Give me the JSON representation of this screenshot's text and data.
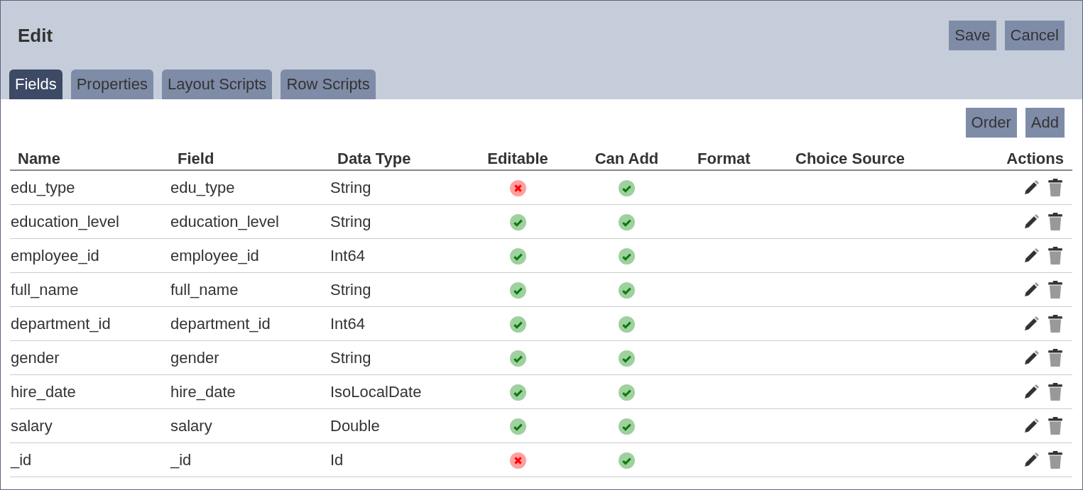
{
  "window": {
    "title": "Edit"
  },
  "header_buttons": [
    "Save",
    "Cancel"
  ],
  "tabs": [
    {
      "label": "Fields",
      "selected": true
    },
    {
      "label": "Properties",
      "selected": false
    },
    {
      "label": "Layout Scripts",
      "selected": false
    },
    {
      "label": "Row Scripts",
      "selected": false
    }
  ],
  "toolbar_buttons": [
    "Order",
    "Add"
  ],
  "table": {
    "columns": [
      "Name",
      "Field",
      "Data Type",
      "Editable",
      "Can Add",
      "Format",
      "Choice Source",
      "Actions"
    ],
    "rows": [
      {
        "name": "edu_type",
        "field": "edu_type",
        "data_type": "String",
        "editable": false,
        "can_add": true
      },
      {
        "name": "education_level",
        "field": "education_level",
        "data_type": "String",
        "editable": true,
        "can_add": true
      },
      {
        "name": "employee_id",
        "field": "employee_id",
        "data_type": "Int64",
        "editable": true,
        "can_add": true
      },
      {
        "name": "full_name",
        "field": "full_name",
        "data_type": "String",
        "editable": true,
        "can_add": true
      },
      {
        "name": "department_id",
        "field": "department_id",
        "data_type": "Int64",
        "editable": true,
        "can_add": true
      },
      {
        "name": "gender",
        "field": "gender",
        "data_type": "String",
        "editable": true,
        "can_add": true
      },
      {
        "name": "hire_date",
        "field": "hire_date",
        "data_type": "IsoLocalDate",
        "editable": true,
        "can_add": true
      },
      {
        "name": "salary",
        "field": "salary",
        "data_type": "Double",
        "editable": true,
        "can_add": true
      },
      {
        "name": "_id",
        "field": "_id",
        "data_type": "Id",
        "editable": false,
        "can_add": true
      }
    ]
  }
}
